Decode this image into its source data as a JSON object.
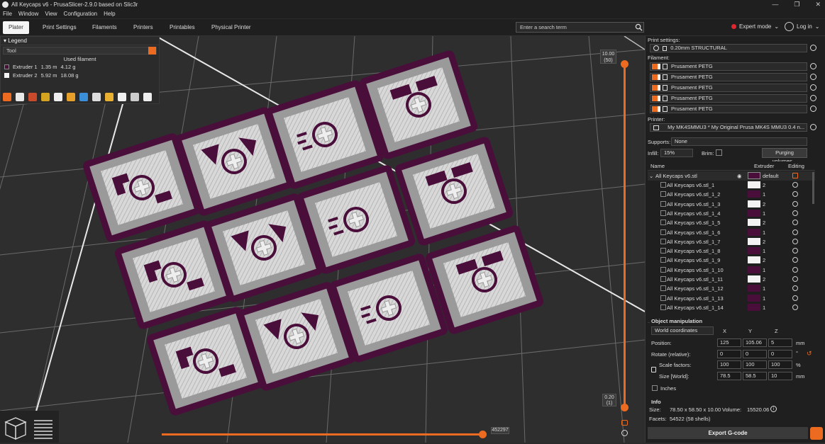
{
  "window": {
    "title": "All Keycaps v6 - PrusaSlicer-2.9.0 based on Slic3r",
    "min": "—",
    "max": "❐",
    "close": "✕"
  },
  "menu": [
    "File",
    "Window",
    "View",
    "Configuration",
    "Help"
  ],
  "tabs": [
    "Plater",
    "Print Settings",
    "Filaments",
    "Printers",
    "Printables",
    "Physical Printer"
  ],
  "search": {
    "placeholder": "Enter a search term"
  },
  "mode": {
    "label": "Expert mode",
    "color": "#e0262e"
  },
  "login": {
    "label": "Log in"
  },
  "legend": {
    "title": "Legend",
    "view_type": "Tool",
    "column": "Used filament",
    "extruders": [
      {
        "name": "Extruder 1",
        "length": "1.35 m",
        "weight": "4.12 g",
        "color": "#4a0e3b"
      },
      {
        "name": "Extruder 2",
        "length": "5.92 m",
        "weight": "18.08 g",
        "color": "#f3f3f3"
      }
    ]
  },
  "vertical_slider": {
    "top_value": "10.00",
    "top_layer": "(50)",
    "bottom_value": "0.20",
    "bottom_layer": "(1)"
  },
  "horizontal_slider": {
    "value": "452297"
  },
  "sidebar": {
    "print_settings_label": "Print settings:",
    "print_profile": "0.20mm STRUCTURAL",
    "filament_label": "Filament:",
    "filaments": [
      "Prusament PETG",
      "Prusament PETG",
      "Prusament PETG",
      "Prusament PETG",
      "Prusament PETG"
    ],
    "printer_label": "Printer:",
    "printer": "My MK4SMMU3 * My Original Prusa MK4S MMU3 0.4 n...",
    "supports_label": "Supports:",
    "supports_value": "None",
    "infill_label": "Infill:",
    "infill_value": "15%",
    "brim_label": "Brim:",
    "purging_button": "Purging volumes..."
  },
  "object_list": {
    "headers": {
      "name": "Name",
      "extruder": "Extruder",
      "editing": "Editing"
    },
    "root": {
      "name": "All Keycaps v6.stl",
      "extruder": "default"
    },
    "parts": [
      {
        "name": "All Keycaps v6.stl_1",
        "extruder": "2"
      },
      {
        "name": "All Keycaps v6.stl_1_2",
        "extruder": "1"
      },
      {
        "name": "All Keycaps v6.stl_1_3",
        "extruder": "2"
      },
      {
        "name": "All Keycaps v6.stl_1_4",
        "extruder": "1"
      },
      {
        "name": "All Keycaps v6.stl_1_5",
        "extruder": "2"
      },
      {
        "name": "All Keycaps v6.stl_1_6",
        "extruder": "1"
      },
      {
        "name": "All Keycaps v6.stl_1_7",
        "extruder": "2"
      },
      {
        "name": "All Keycaps v6.stl_1_8",
        "extruder": "1"
      },
      {
        "name": "All Keycaps v6.stl_1_9",
        "extruder": "2"
      },
      {
        "name": "All Keycaps v6.stl_1_10",
        "extruder": "1"
      },
      {
        "name": "All Keycaps v6.stl_1_11",
        "extruder": "2"
      },
      {
        "name": "All Keycaps v6.stl_1_12",
        "extruder": "1"
      },
      {
        "name": "All Keycaps v6.stl_1_13",
        "extruder": "1"
      },
      {
        "name": "All Keycaps v6.stl_1_14",
        "extruder": "1"
      }
    ]
  },
  "object_manipulation": {
    "title": "Object manipulation",
    "coord_system": "World coordinates",
    "axes": [
      "X",
      "Y",
      "Z"
    ],
    "position_label": "Position:",
    "position": [
      "125",
      "105.06",
      "5"
    ],
    "position_unit": "mm",
    "rotate_label": "Rotate (relative):",
    "rotate": [
      "0",
      "0",
      "0"
    ],
    "rotate_unit": "°",
    "scale_label": "Scale factors:",
    "scale": [
      "100",
      "100",
      "100"
    ],
    "scale_unit": "%",
    "size_label": "Size [World]:",
    "size": [
      "78.5",
      "58.5",
      "10"
    ],
    "size_unit": "mm",
    "inches_label": "Inches"
  },
  "info": {
    "title": "Info",
    "size_label": "Size:",
    "size_value": "78.50 x 58.50 x 10.00",
    "volume_label": "Volume:",
    "volume_value": "15520.06",
    "facets_label": "Facets:",
    "facets_value": "54522 (58 shells)"
  },
  "export_button": "Export G-code",
  "colors": {
    "accent": "#ed6b21",
    "extruder1": "#4a0e3b",
    "extruder2": "#f3f3f3"
  }
}
